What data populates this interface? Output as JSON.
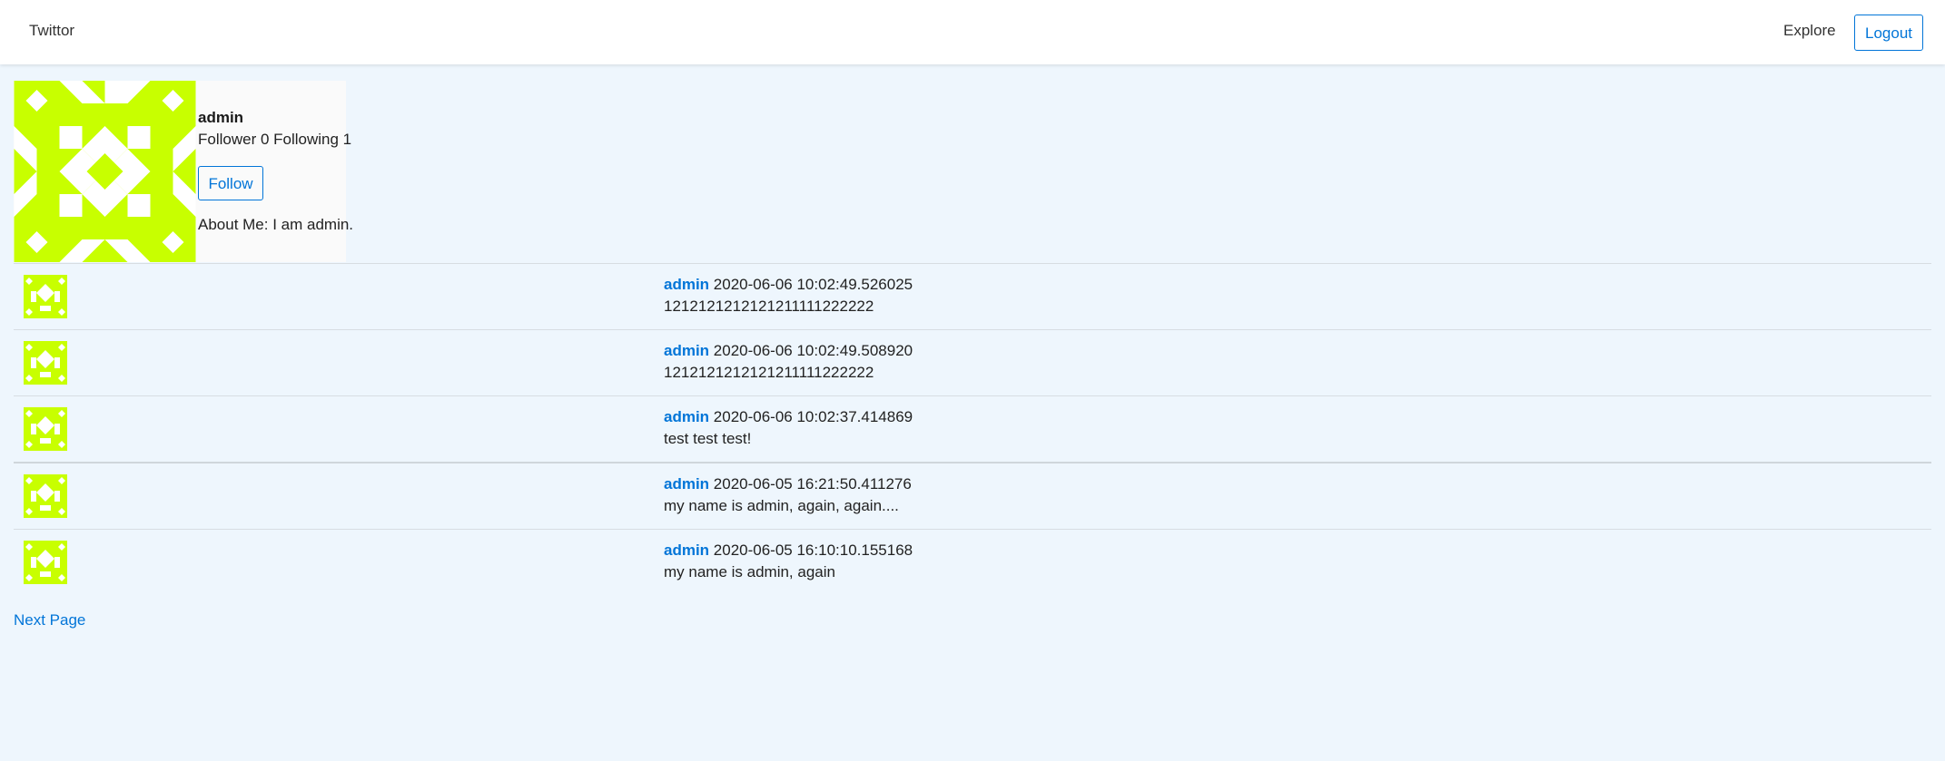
{
  "nav": {
    "brand": "Twittor",
    "explore": "Explore",
    "logout": "Logout"
  },
  "profile": {
    "username": "admin",
    "stats": "Follower 0 Following 1",
    "follow_label": "Follow",
    "about": "About Me: I am admin.",
    "avatar_color": "#c8ff00"
  },
  "posts": [
    {
      "author": "admin",
      "timestamp": "2020-06-06 10:02:49.526025",
      "body": "1212121212121211111222222"
    },
    {
      "author": "admin",
      "timestamp": "2020-06-06 10:02:49.508920",
      "body": "1212121212121211111222222"
    },
    {
      "author": "admin",
      "timestamp": "2020-06-06 10:02:37.414869",
      "body": "test test test!"
    },
    {
      "author": "admin",
      "timestamp": "2020-06-05 16:21:50.411276",
      "body": "my name is admin, again, again...."
    },
    {
      "author": "admin",
      "timestamp": "2020-06-05 16:10:10.155168",
      "body": "my name is admin, again"
    }
  ],
  "pagination": {
    "next": "Next Page"
  },
  "colors": {
    "accent": "#0275d8",
    "background": "#eef6fd"
  }
}
